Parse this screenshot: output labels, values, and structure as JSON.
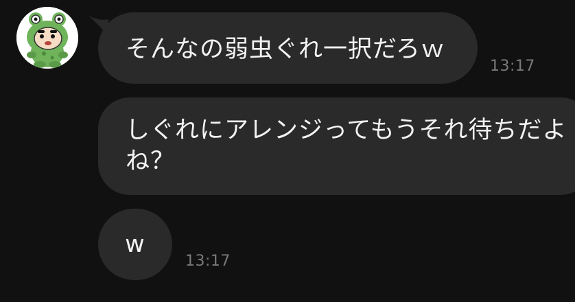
{
  "contact": {
    "avatar_icon": "frog-costume-cartoon-avatar-icon"
  },
  "messages": [
    {
      "text": "そんなの弱虫ぐれ一択だろｗ",
      "time": "13:17"
    },
    {
      "lines": [
        "しぐれにアレンジってもうそれ待ちだよ",
        "ね？"
      ]
    },
    {
      "text": "w",
      "time": "13:17"
    }
  ],
  "colors": {
    "background": "#111111",
    "bubble": "#2a2a2a",
    "text": "#f2f2f2",
    "timestamp": "#7a7a7a"
  }
}
